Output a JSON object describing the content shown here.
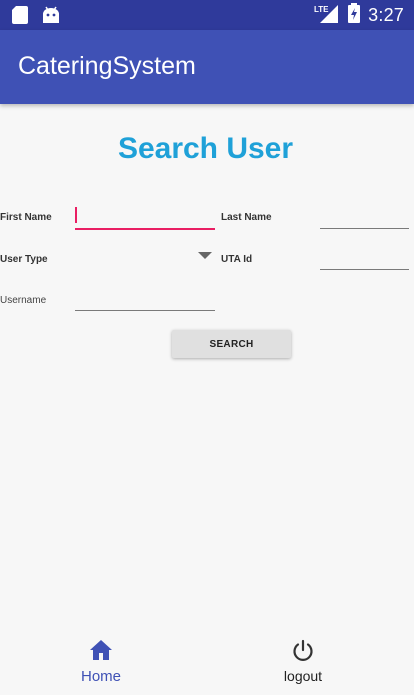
{
  "status_bar": {
    "time": "3:27",
    "network_label": "LTE",
    "icons": [
      "sd-card-icon",
      "android-icon",
      "signal-icon",
      "battery-charging-icon"
    ]
  },
  "app_bar": {
    "title": "CateringSystem"
  },
  "main": {
    "heading": "Search User",
    "fields": {
      "first_name": {
        "label": "First Name",
        "value": ""
      },
      "last_name": {
        "label": "Last Name",
        "value": ""
      },
      "user_type": {
        "label": "User Type",
        "selected": ""
      },
      "uta_id": {
        "label": "UTA Id",
        "value": ""
      },
      "username": {
        "label": "Username",
        "value": ""
      }
    },
    "search_button_label": "SEARCH"
  },
  "bottom_nav": {
    "items": [
      {
        "label": "Home",
        "icon": "home-icon",
        "active": true
      },
      {
        "label": "logout",
        "icon": "power-icon",
        "active": false
      }
    ]
  },
  "colors": {
    "status_bar": "#2f3a9b",
    "app_bar": "#3f51b5",
    "heading": "#1fa1d8",
    "focus_accent": "#e91e63",
    "nav_active": "#3f51b5"
  }
}
